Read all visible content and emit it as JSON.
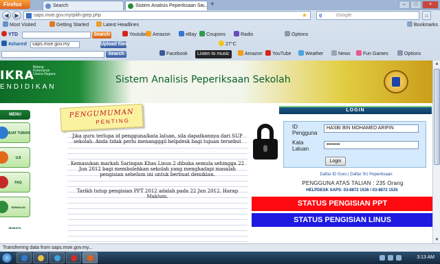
{
  "browser": {
    "menu_button": "Firefox",
    "tabs": [
      {
        "label": "Search"
      },
      {
        "label": "Sistem Analisis Peperiksaan Se..."
      }
    ],
    "url": "saps.moe.gov.my/pilih-jpep.php",
    "search_placeholder": "Google",
    "bookmarks": [
      "Most Visited",
      "Getting Started",
      "Latest Headlines"
    ],
    "bookmarks_right": "Bookmarks",
    "toolbar1": {
      "brand": "YTD",
      "search_label": "Search",
      "items": [
        "Youtube",
        "Amazon",
        "eBay",
        "Coupons",
        "Radio",
        "Options"
      ]
    },
    "toolbar2": {
      "brand": "4shared",
      "input_value": "saps.moe.gov.my",
      "button": "Upload files",
      "temp": "27°C"
    },
    "toolbar3": {
      "search_label": "Search",
      "items": [
        "Facebook",
        "Listen to music",
        "Amazon",
        "YouTube",
        "Weather",
        "News",
        "Fun Games",
        "Options"
      ]
    },
    "status_text": "Transferring data from saps.moe.gov.my..."
  },
  "site": {
    "logo_main": "IKRA",
    "logo_small": "Bidang Kebenaran Utama Negara",
    "logo_sub": "ENDIDIKAN",
    "title": "Sistem Analisis Peperiksaan Sekolah"
  },
  "menu": {
    "header": "MENU",
    "items": [
      {
        "label": "MUAT TURUN",
        "color": "#2f7ad0"
      },
      {
        "label": "UJI KELAJUAN",
        "color": "#e46a1b"
      },
      {
        "label": "FAQ",
        "color": "#c62828"
      },
      {
        "label": "SEMAKAN IBUBAPA",
        "color": "#2e8b3a"
      }
    ]
  },
  "announcement": {
    "title_line1": "PENGUMUMAN",
    "title_line2": "PENTING",
    "paragraphs": [
      "Jika guru terlupa id pengguna/kata laluan, sila dapatkannya dari SUP sekolah. Anda tidak perlu menangggil helpdesk bagi tujuan tersebut",
      "Kemasukan markah Saringan Khas Linus 2 dibuka semula sehingga 22 Jun 2012 bagi membolehkan sekolah yang menghadapi masalah pengisian sebelum ini untuk berbuat demikian.",
      "Tarikh tutup pengisian PPT 2012 adalah pada 22 Jun 2012. Harap Maklum."
    ]
  },
  "login": {
    "header": "LOGIN",
    "id_label_1": "ID",
    "id_label_2": "Pengguna",
    "id_value": "HASBI BIN MOHAMED ARIFIN",
    "pass_label_1": "Kata",
    "pass_label_2": "Laluan",
    "pass_value": "••••••••",
    "button": "Login",
    "links": "Daftar ID Guru | Daftar SU Peperiksaan",
    "online_text": "PENGGUNA ATAS TALIAN : 235 Orang",
    "helpdesk": "HELPDESK SAPS: 03-8872 1536 / 03-8872 1535"
  },
  "buttons": {
    "ppt": "STATUS PENGISIAN PPT",
    "linus": "STATUS PENGISIAN LINUS"
  },
  "taskbar": {
    "clock": "3:13 AM"
  }
}
